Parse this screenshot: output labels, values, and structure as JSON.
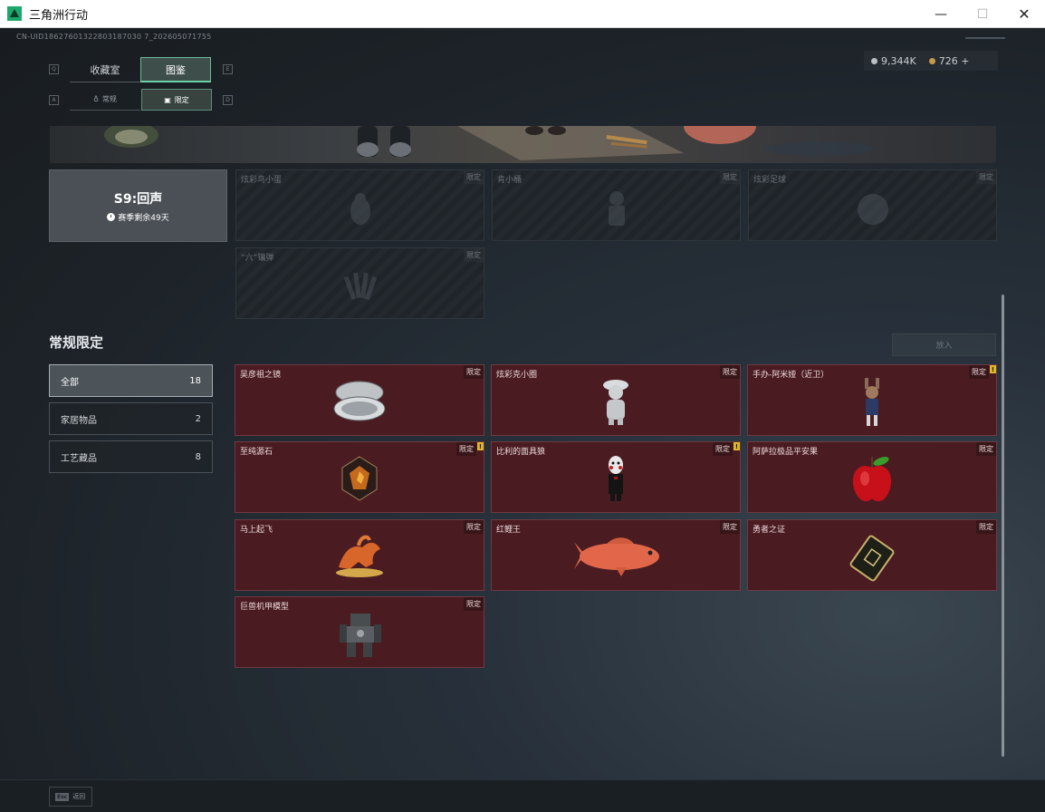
{
  "window": {
    "title": "三角洲行动",
    "min": "—",
    "max": "☐",
    "close": "✕"
  },
  "uid": "CN-UID18627601322803187030 7_202605071755",
  "currency": {
    "silver": "9,344K",
    "gold": "726 +"
  },
  "nav": {
    "keys": {
      "q": "Q",
      "e": "E",
      "a": "A",
      "d": "D"
    },
    "main_tabs": [
      {
        "label": "收藏室"
      },
      {
        "label": "图鉴"
      }
    ],
    "sub_tabs": [
      {
        "label": "常规"
      },
      {
        "label": "限定"
      }
    ]
  },
  "season": {
    "title": "S9:回声",
    "remaining": "赛季剩余49天"
  },
  "season_items": [
    {
      "name": "炫彩鸟小蛋",
      "tag": "限定"
    },
    {
      "name": "肯小桶",
      "tag": "限定"
    },
    {
      "name": "炫彩足球",
      "tag": "限定"
    },
    {
      "name": "“六”镶弹",
      "tag": "限定"
    }
  ],
  "section": {
    "title": "常规限定",
    "put_button": "放入"
  },
  "filters": [
    {
      "label": "全部",
      "count": "18"
    },
    {
      "label": "家居物品",
      "count": "2"
    },
    {
      "label": "工艺藏品",
      "count": "8"
    }
  ],
  "items": [
    {
      "name": "吴彦祖之镜",
      "tag": "限定",
      "badge": ""
    },
    {
      "name": "炫彩克小圈",
      "tag": "限定",
      "badge": ""
    },
    {
      "name": "手办-阿米娅（近卫）",
      "tag": "限定",
      "badge": "!"
    },
    {
      "name": "至纯源石",
      "tag": "限定",
      "badge": "!"
    },
    {
      "name": "比利的面具狼",
      "tag": "限定",
      "badge": "!"
    },
    {
      "name": "阿萨拉极品平安果",
      "tag": "限定",
      "badge": ""
    },
    {
      "name": "马上起飞",
      "tag": "限定",
      "badge": ""
    },
    {
      "name": "红鲤王",
      "tag": "限定",
      "badge": ""
    },
    {
      "name": "勇者之证",
      "tag": "限定",
      "badge": ""
    },
    {
      "name": "巨兽机甲模型",
      "tag": "限定",
      "badge": ""
    }
  ],
  "bottom": {
    "esc_key": "Esc",
    "back": "返回"
  }
}
